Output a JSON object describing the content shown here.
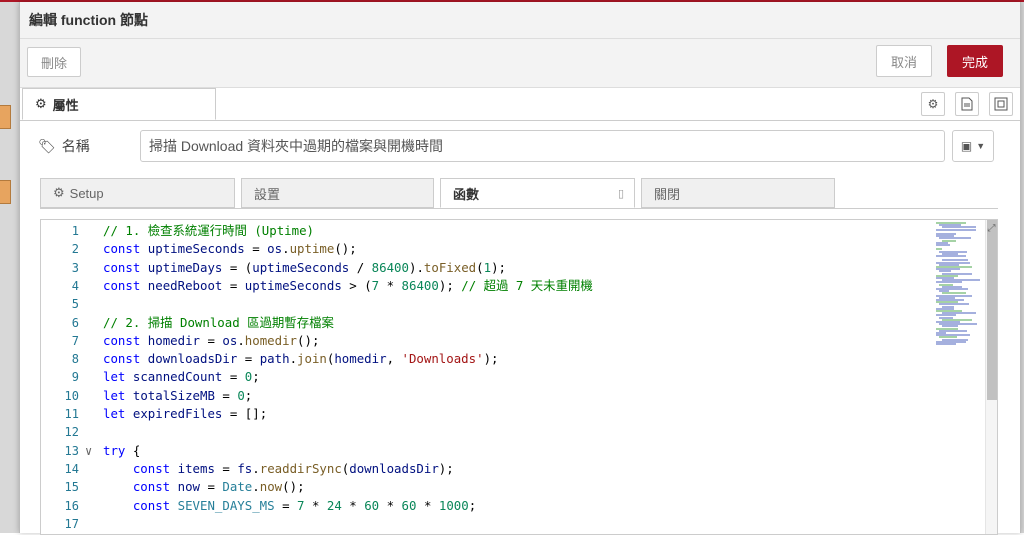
{
  "dialog": {
    "title": "編輯 function 節點"
  },
  "toolbar": {
    "delete_label": "刪除",
    "cancel_label": "取消",
    "done_label": "完成"
  },
  "tabs": {
    "properties_label": "屬性"
  },
  "name_field": {
    "label": "名稱",
    "value": "掃描 Download 資料夾中過期的檔案與開機時間"
  },
  "subtabs": [
    {
      "label": "Setup"
    },
    {
      "label": "設置"
    },
    {
      "label": "函數"
    },
    {
      "label": "關閉"
    }
  ],
  "code_lines": [
    {
      "n": "1",
      "text": "// 1. 檢查系統運行時間 (Uptime)"
    },
    {
      "n": "2",
      "text": "const uptimeSeconds = os.uptime();"
    },
    {
      "n": "3",
      "text": "const uptimeDays = (uptimeSeconds / 86400).toFixed(1);"
    },
    {
      "n": "4",
      "text": "const needReboot = uptimeSeconds > (7 * 86400); // 超過 7 天未重開機"
    },
    {
      "n": "5",
      "text": ""
    },
    {
      "n": "6",
      "text": "// 2. 掃描 Download 區過期暫存檔案"
    },
    {
      "n": "7",
      "text": "const homedir = os.homedir();"
    },
    {
      "n": "8",
      "text": "const downloadsDir = path.join(homedir, 'Downloads');"
    },
    {
      "n": "9",
      "text": "let scannedCount = 0;"
    },
    {
      "n": "10",
      "text": "let totalSizeMB = 0;"
    },
    {
      "n": "11",
      "text": "let expiredFiles = [];"
    },
    {
      "n": "12",
      "text": ""
    },
    {
      "n": "13",
      "text": "try {"
    },
    {
      "n": "14",
      "text": "    const items = fs.readdirSync(downloadsDir);"
    },
    {
      "n": "15",
      "text": "    const now = Date.now();"
    },
    {
      "n": "16",
      "text": "    const SEVEN_DAYS_MS = 7 * 24 * 60 * 60 * 1000;"
    },
    {
      "n": "17",
      "text": ""
    }
  ]
}
